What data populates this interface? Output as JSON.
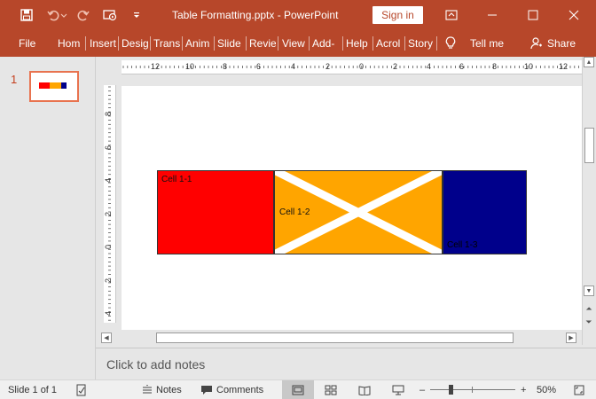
{
  "titlebar": {
    "document_title": "Table Formatting.pptx  -  PowerPoint",
    "signin_label": "Sign in",
    "accent": "#b7472a"
  },
  "ribbon": {
    "tabs": [
      "File",
      "Hom",
      "Insert",
      "Desig",
      "Trans",
      "Anim",
      "Slide",
      "Revie",
      "View",
      "Add-",
      "Help",
      "Acrol",
      "Story"
    ],
    "tell_me": "Tell me",
    "share": "Share"
  },
  "thumbnails": {
    "slide_number": "1"
  },
  "rulers": {
    "horizontal": [
      "12",
      "10",
      "8",
      "6",
      "4",
      "2",
      "0",
      "2",
      "4",
      "6",
      "8",
      "10",
      "12"
    ],
    "vertical": [
      "8",
      "6",
      "4",
      "2",
      "0",
      "2",
      "4"
    ]
  },
  "slide": {
    "cells": [
      {
        "label": "Cell 1-1",
        "color": "#ff0000"
      },
      {
        "label": "Cell 1-2",
        "color": "#ffa500"
      },
      {
        "label": "Cell 1-3",
        "color": "#00008b"
      }
    ],
    "cross_color": "#ffffff"
  },
  "notes": {
    "placeholder": "Click to add notes"
  },
  "statusbar": {
    "slide_info": "Slide 1 of 1",
    "notes_label": "Notes",
    "comments_label": "Comments",
    "zoom_minus": "–",
    "zoom_plus": "+",
    "zoom_level": "50%",
    "zoom_fraction": 0.5
  },
  "icons": [
    "save-icon",
    "undo-icon",
    "redo-icon",
    "present-icon",
    "customize-icon",
    "ribbon-display-icon",
    "minimize-icon",
    "maximize-icon",
    "close-icon",
    "lightbulb-icon",
    "share-icon",
    "notes-icon",
    "comments-icon",
    "normal-view-icon",
    "slide-sorter-icon",
    "reading-view-icon",
    "slideshow-icon",
    "fit-slide-icon"
  ]
}
